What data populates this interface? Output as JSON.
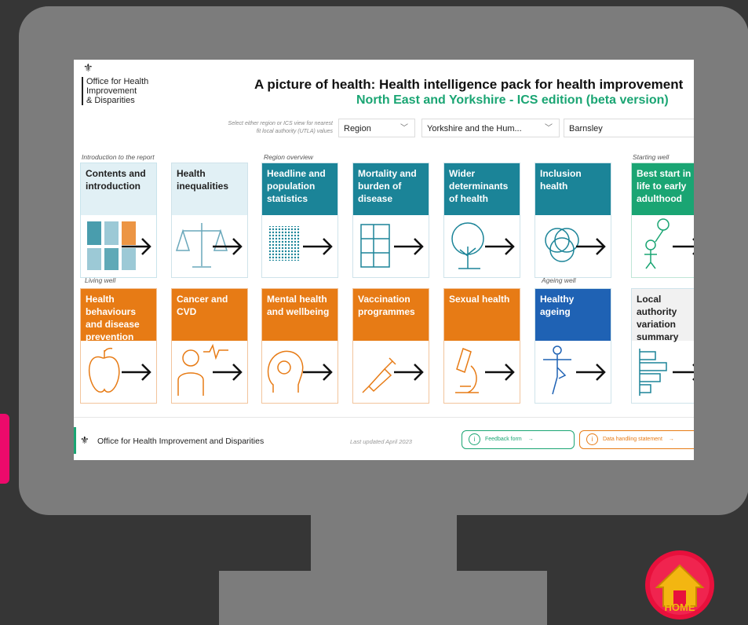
{
  "report": {
    "logo_lines": [
      "Office for Health",
      "Improvement",
      "& Disparities"
    ],
    "title": "A picture of health: Health intelligence pack for health improvement",
    "subtitle": "North East and Yorkshire - ICS edition (beta version)",
    "hint_lines": [
      "Select either region or ICS view for nearest",
      "fit local authority (UTLA) values"
    ],
    "selects": [
      {
        "value": "Region"
      },
      {
        "value": "Yorkshire and the Hum..."
      },
      {
        "value": "Barnsley"
      }
    ],
    "sections": {
      "intro": "Introduction to the report",
      "region": "Region overview",
      "starting": "Starting well",
      "living": "Living well",
      "ageing": "Ageing well"
    },
    "tiles_row1": [
      {
        "label": "Contents and introduction",
        "icon": "report-pages-icon",
        "style": "blue"
      },
      {
        "label": "Health inequalities",
        "icon": "scales-icon",
        "style": "grey"
      },
      {
        "label": "Headline and population statistics",
        "icon": "population-grid-icon",
        "style": "teal"
      },
      {
        "label": "Mortality and burden of disease",
        "icon": "table-chart-icon",
        "style": "teal"
      },
      {
        "label": "Wider determinants of health",
        "icon": "tree-icon",
        "style": "teal"
      },
      {
        "label": "Inclusion health",
        "icon": "venn-icon",
        "style": "teal"
      },
      {
        "label": "Best start in life to early adulthood",
        "icon": "child-balloon-icon",
        "style": "green"
      }
    ],
    "tiles_row2": [
      {
        "label": "Health behaviours and disease prevention",
        "icon": "apple-icon",
        "style": "orange"
      },
      {
        "label": "Cancer and CVD",
        "icon": "heartbeat-person-icon",
        "style": "orange"
      },
      {
        "label": "Mental health and wellbeing",
        "icon": "head-gears-icon",
        "style": "orange"
      },
      {
        "label": "Vaccination programmes",
        "icon": "syringe-icon",
        "style": "orange"
      },
      {
        "label": "Sexual health",
        "icon": "microscope-icon",
        "style": "orange"
      },
      {
        "label": "Healthy ageing",
        "icon": "yoga-pose-icon",
        "style": "dblue"
      },
      {
        "label": "Local authority variation summary",
        "icon": "bar-list-icon",
        "style": "grey"
      }
    ],
    "footer": {
      "org": "Office for Health Improvement and Disparities",
      "updated": "Last updated April 2023",
      "feedback": "Feedback form",
      "data_statement": "Data handling statement"
    }
  },
  "home_button": {
    "label": "HOME"
  },
  "colors": {
    "teal": "#1b8498",
    "green": "#1aa573",
    "orange": "#e77b15",
    "dark_blue": "#1f62b4",
    "pink": "#ec0a6b",
    "home_red": "#e8103c",
    "home_yellow": "#f3b611"
  }
}
